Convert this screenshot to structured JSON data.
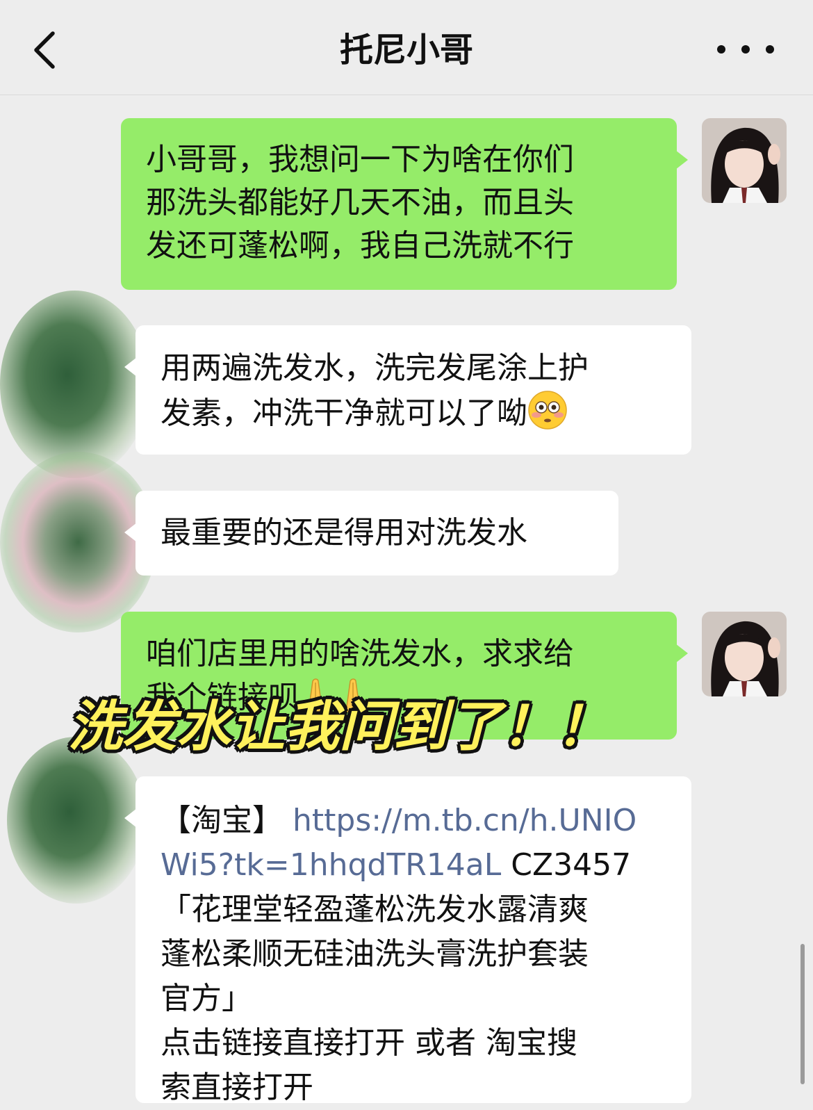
{
  "header": {
    "title": "托尼小哥",
    "back_icon": "chevron-left-icon",
    "more_icon": "more-dots-icon"
  },
  "messages": [
    {
      "sender": "me",
      "lines": [
        "小哥哥，我想问一下为啥在你们",
        "那洗头都能好几天不油，而且头",
        "发还可蓬松啊，我自己洗就不行"
      ]
    },
    {
      "sender": "other",
      "lines": [
        "用两遍洗发水，洗完发尾涂上护",
        "发素，冲洗干净就可以了呦"
      ],
      "emoji": "flushed-face-emoji"
    },
    {
      "sender": "other",
      "lines": [
        "最重要的还是得用对洗发水"
      ]
    },
    {
      "sender": "me",
      "lines": [
        "咱们店里用的啥洗发水，求求给",
        "我个链接呗"
      ],
      "emoji": "folded-hands-emoji"
    },
    {
      "sender": "other",
      "bracket": "【淘宝】",
      "link_line1": "https://m.tb.cn/h.UNIO",
      "link_line2": "Wi5?tk=1hhqdTR14aL",
      "code": " CZ3457",
      "lines": [
        "「花理堂轻盈蓬松洗发水露清爽",
        "蓬松柔顺无硅油洗头膏洗护套装",
        "官方」",
        "点击链接直接打开 或者 淘宝搜",
        "索直接打开"
      ]
    }
  ],
  "overlay": {
    "caption": "洗发水让我问到了！！"
  },
  "colors": {
    "background": "#ededed",
    "my_bubble": "#95ec69",
    "other_bubble": "#ffffff",
    "link": "#576b95",
    "caption_fill": "#fff15c"
  }
}
